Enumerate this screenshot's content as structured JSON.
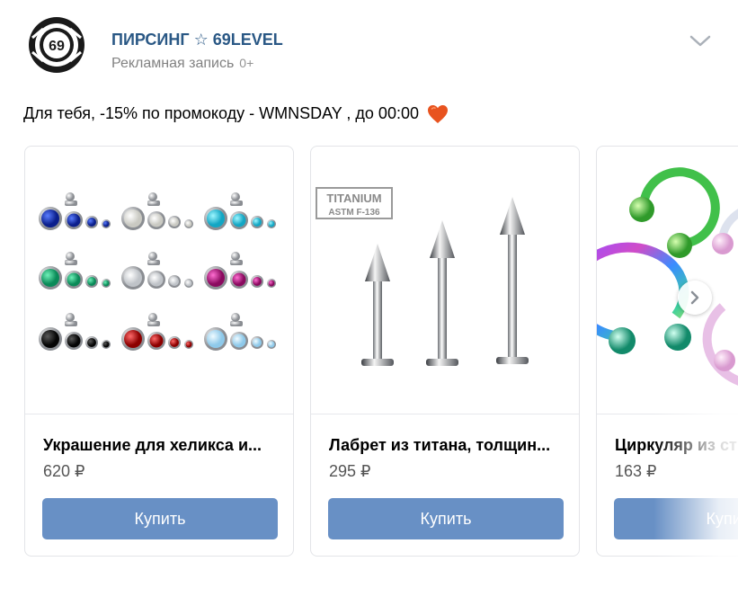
{
  "post": {
    "author": "ПИРСИНГ ☆ 69LEVEL",
    "subtitle": "Рекламная запись",
    "age_rating": "0+",
    "avatar_text": "69",
    "text": "Для тебя, -15% по промокоду - WMNSDAY , до 00:00",
    "emoji": "heart-emoji"
  },
  "products": [
    {
      "title": "Украшение для хеликса и...",
      "price": "620 ₽",
      "button": "Купить"
    },
    {
      "title": "Лабрет из титана, толщин...",
      "price": "295 ₽",
      "button": "Купить",
      "badge_line1": "TITANIUM",
      "badge_line2": "ASTM F-136"
    },
    {
      "title": "Циркуляр из ст",
      "price": "163 ₽",
      "button": "Купить"
    }
  ],
  "colors": {
    "link": "#2a5885",
    "button": "#6890c5",
    "muted": "#828282"
  },
  "icons": [
    "chevron-down-icon",
    "chevron-right-icon",
    "heart-icon"
  ]
}
